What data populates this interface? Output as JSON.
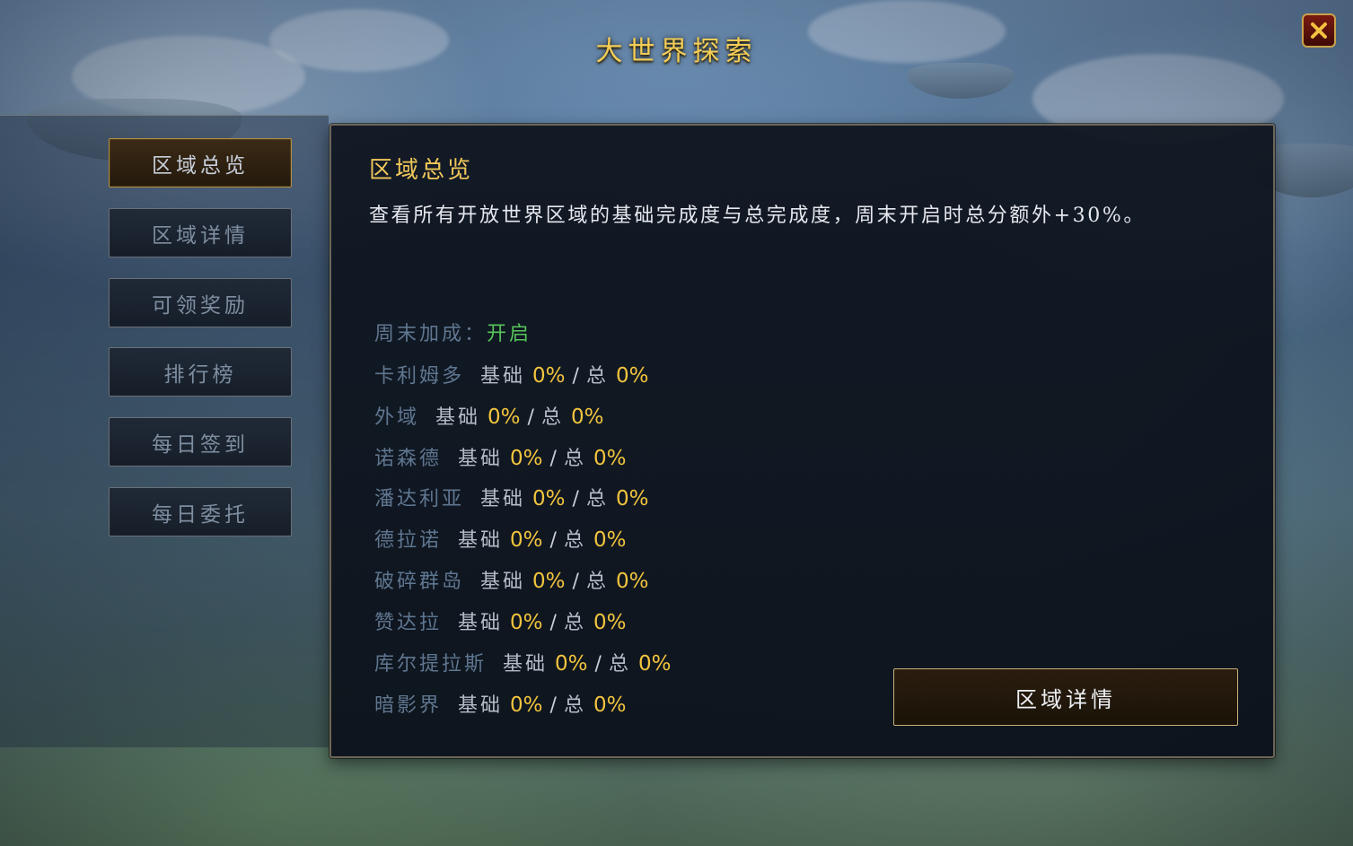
{
  "window": {
    "title": "大世界探索",
    "close_icon": "close-icon"
  },
  "sidebar": {
    "items": [
      {
        "label": "区域总览",
        "active": true
      },
      {
        "label": "区域详情",
        "active": false
      },
      {
        "label": "可领奖励",
        "active": false
      },
      {
        "label": "排行榜",
        "active": false
      },
      {
        "label": "每日签到",
        "active": false
      },
      {
        "label": "每日委托",
        "active": false
      }
    ]
  },
  "main": {
    "title": "区域总览",
    "description": "查看所有开放世界区域的基础完成度与总完成度，周末开启时总分额外+30%。",
    "weekend": {
      "label": "周末加成：",
      "value": "开启"
    },
    "base_label": "基础",
    "sep": "/",
    "total_label": "总",
    "zones": [
      {
        "name": "卡利姆多",
        "base": "0%",
        "total": "0%"
      },
      {
        "name": "外域",
        "base": "0%",
        "total": "0%"
      },
      {
        "name": "诺森德",
        "base": "0%",
        "total": "0%"
      },
      {
        "name": "潘达利亚",
        "base": "0%",
        "total": "0%"
      },
      {
        "name": "德拉诺",
        "base": "0%",
        "total": "0%"
      },
      {
        "name": "破碎群岛",
        "base": "0%",
        "total": "0%"
      },
      {
        "name": "赞达拉",
        "base": "0%",
        "total": "0%"
      },
      {
        "name": "库尔提拉斯",
        "base": "0%",
        "total": "0%"
      },
      {
        "name": "暗影界",
        "base": "0%",
        "total": "0%"
      }
    ],
    "detail_button": "区域详情"
  },
  "colors": {
    "gold": "#f2c43e",
    "title_gold": "#f0c85a",
    "on_green": "#57c35a",
    "muted_blue": "#5f7690"
  }
}
